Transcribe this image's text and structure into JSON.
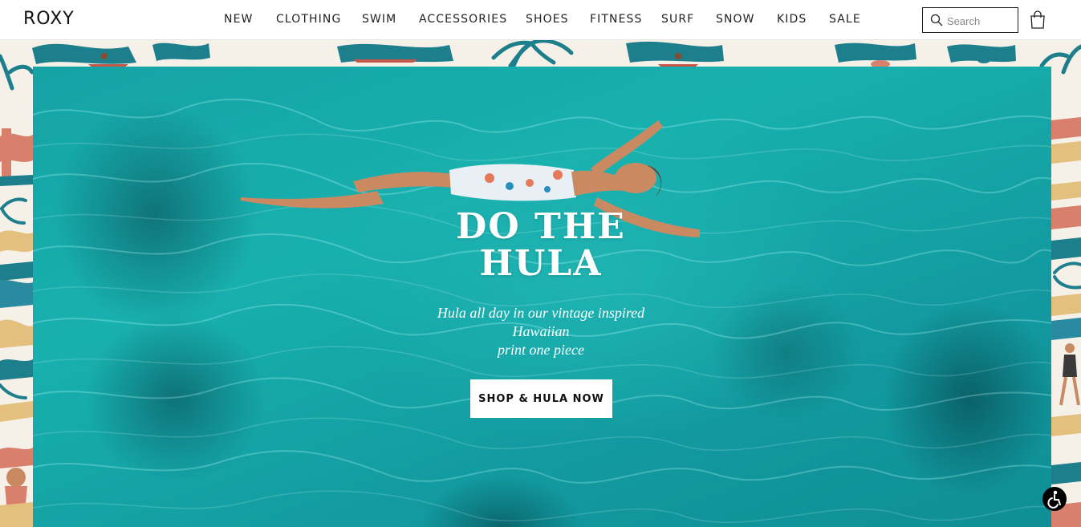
{
  "brand": {
    "logo_text": "ROXY"
  },
  "nav": {
    "items": [
      {
        "label": "NEW"
      },
      {
        "label": "CLOTHING"
      },
      {
        "label": "SWIM"
      },
      {
        "label": "ACCESSORIES"
      },
      {
        "label": "SHOES"
      },
      {
        "label": "FITNESS"
      },
      {
        "label": "SURF"
      },
      {
        "label": "SNOW"
      },
      {
        "label": "KIDS"
      },
      {
        "label": "SALE"
      }
    ]
  },
  "search": {
    "placeholder": "Search",
    "icon": "search-icon"
  },
  "cart": {
    "icon": "shopping-bag-icon"
  },
  "hero": {
    "headline_line1": "DO THE",
    "headline_line2": "HULA",
    "subtext_line1": "Hula all day in our vintage inspired",
    "subtext_line2": "Hawaiian",
    "subtext_line3": "print one piece",
    "cta_label": "SHOP & HULA NOW"
  },
  "accessibility": {
    "icon": "accessibility-icon"
  },
  "colors": {
    "water": "#18b0ae",
    "border_background": "#f6f1e8",
    "palm_teal": "#1e7f8c",
    "coral": "#d9806c",
    "sand": "#e3c07e"
  }
}
